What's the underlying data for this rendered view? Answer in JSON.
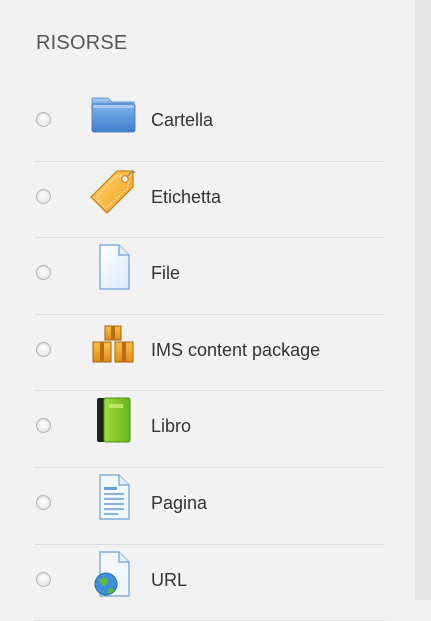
{
  "section": {
    "title": "RISORSE"
  },
  "items": [
    {
      "label": "Cartella",
      "icon": "folder-icon"
    },
    {
      "label": "Etichetta",
      "icon": "tag-icon"
    },
    {
      "label": "File",
      "icon": "file-icon"
    },
    {
      "label": "IMS content package",
      "icon": "ims-package-icon"
    },
    {
      "label": "Libro",
      "icon": "book-icon"
    },
    {
      "label": "Pagina",
      "icon": "page-icon"
    },
    {
      "label": "URL",
      "icon": "url-icon"
    }
  ],
  "colors": {
    "background": "#f2f2f2",
    "divider": "#dcdcdc",
    "text": "#333333"
  }
}
